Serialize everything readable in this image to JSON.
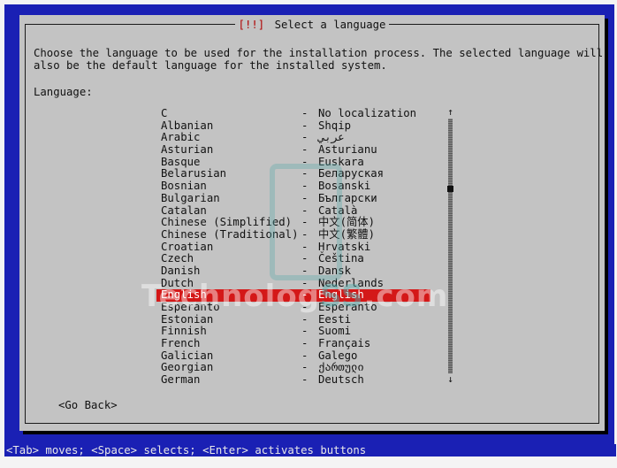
{
  "dialog": {
    "title_bracket": "[!!]",
    "title_text": "Select a language",
    "description_line1": "Choose the language to be used for the installation process. The selected language will",
    "description_line2": "also be the default language for the installed system.",
    "language_label": "Language:",
    "go_back": "<Go Back>"
  },
  "languages": [
    {
      "name": "C",
      "native": "No localization"
    },
    {
      "name": "Albanian",
      "native": "Shqip"
    },
    {
      "name": "Arabic",
      "native": "عربي"
    },
    {
      "name": "Asturian",
      "native": "Asturianu"
    },
    {
      "name": "Basque",
      "native": "Euskara"
    },
    {
      "name": "Belarusian",
      "native": "Беларуская"
    },
    {
      "name": "Bosnian",
      "native": "Bosanski"
    },
    {
      "name": "Bulgarian",
      "native": "Български"
    },
    {
      "name": "Catalan",
      "native": "Català"
    },
    {
      "name": "Chinese (Simplified)",
      "native": "中文(简体)"
    },
    {
      "name": "Chinese (Traditional)",
      "native": "中文(繁體)"
    },
    {
      "name": "Croatian",
      "native": "Hrvatski"
    },
    {
      "name": "Czech",
      "native": "Čeština"
    },
    {
      "name": "Danish",
      "native": "Dansk"
    },
    {
      "name": "Dutch",
      "native": "Nederlands"
    },
    {
      "name": "English",
      "native": "English"
    },
    {
      "name": "Esperanto",
      "native": "Esperanto"
    },
    {
      "name": "Estonian",
      "native": "Eesti"
    },
    {
      "name": "Finnish",
      "native": "Suomi"
    },
    {
      "name": "French",
      "native": "Français"
    },
    {
      "name": "Galician",
      "native": "Galego"
    },
    {
      "name": "Georgian",
      "native": "ქართული"
    },
    {
      "name": "German",
      "native": "Deutsch"
    }
  ],
  "separator": "-",
  "selected_language": "English",
  "status_bar": "<Tab> moves; <Space> selects; <Enter> activates buttons",
  "watermark": {
    "text_a": "Technolog",
    "text_b": "SS",
    "text_c": ".com"
  },
  "colors": {
    "background_blue": "#1a20b4",
    "dialog_gray": "#c3c3c3",
    "selection_red": "#d41818",
    "title_red": "#b00000"
  },
  "icons": {
    "scroll_up": "↑",
    "scroll_down": "↓"
  }
}
